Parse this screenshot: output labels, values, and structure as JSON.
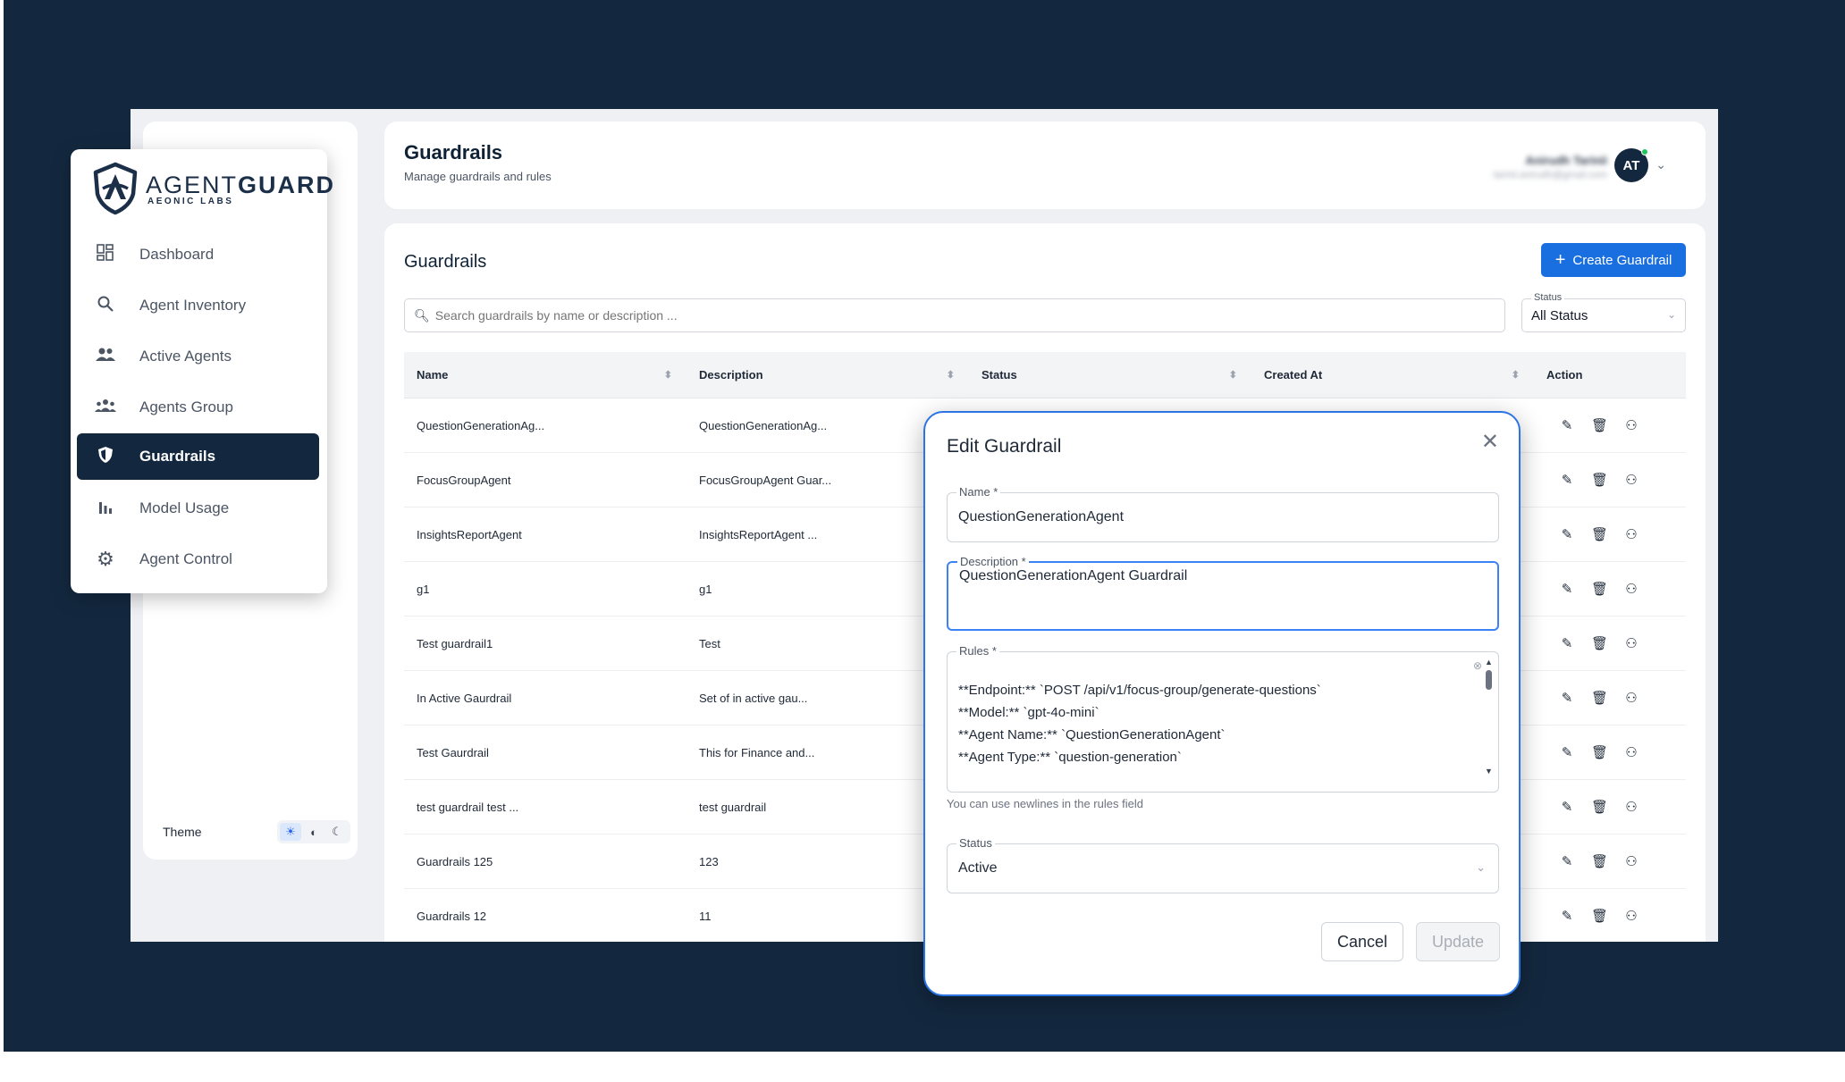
{
  "brand": {
    "name_light": "AGENT",
    "name_bold": "GUARD",
    "sub": "AEONIC LABS"
  },
  "nav": {
    "items": [
      {
        "label": "Dashboard",
        "icon": "dashboard-icon",
        "active": false
      },
      {
        "label": "Agent Inventory",
        "icon": "search-icon",
        "active": false
      },
      {
        "label": "Active Agents",
        "icon": "users-icon",
        "active": false
      },
      {
        "label": "Agents Group",
        "icon": "group-icon",
        "active": false
      },
      {
        "label": "Guardrails",
        "icon": "shield-icon",
        "active": true
      },
      {
        "label": "Model Usage",
        "icon": "bar-chart-icon",
        "active": false
      },
      {
        "label": "Agent Control",
        "icon": "gear-icon",
        "active": false
      }
    ]
  },
  "theme": {
    "label": "Theme"
  },
  "header": {
    "title": "Guardrails",
    "subtitle": "Manage guardrails and rules",
    "user_name": "Anirudh Tarinii",
    "user_email": "tarinii.anirudh@gmail.com",
    "avatar_initials": "AT"
  },
  "content": {
    "title": "Guardrails",
    "create_label": "Create Guardrail",
    "search_placeholder": "Search guardrails by name or description ...",
    "status_filter_label": "Status",
    "status_filter_value": "All Status"
  },
  "table": {
    "columns": [
      "Name",
      "Description",
      "Status",
      "Created At",
      "Action"
    ],
    "rows": [
      {
        "name": "QuestionGenerationAg...",
        "description": "QuestionGenerationAg..."
      },
      {
        "name": "FocusGroupAgent",
        "description": "FocusGroupAgent Guar..."
      },
      {
        "name": "InsightsReportAgent",
        "description": "InsightsReportAgent ..."
      },
      {
        "name": "g1",
        "description": "g1"
      },
      {
        "name": "Test guardrail1",
        "description": "Test"
      },
      {
        "name": "In Active Gaurdrail",
        "description": "Set of in active gau..."
      },
      {
        "name": "Test Gaurdrail",
        "description": "This for Finance and..."
      },
      {
        "name": "test guardrail test ...",
        "description": "test guardrail"
      },
      {
        "name": "Guardrails 125",
        "description": "123"
      },
      {
        "name": "Guardrails 12",
        "description": "11"
      }
    ]
  },
  "modal": {
    "title": "Edit Guardrail",
    "name_label": "Name *",
    "name_value": "QuestionGenerationAgent",
    "description_label": "Description *",
    "description_value": "QuestionGenerationAgent Guardrail",
    "rules_label": "Rules *",
    "rules_lines": [
      "**Endpoint:** `POST /api/v1/focus-group/generate-questions`",
      "**Model:** `gpt-4o-mini`",
      "**Agent Name:** `QuestionGenerationAgent`",
      "**Agent Type:** `question-generation`"
    ],
    "rules_helper": "You can use newlines in the rules field",
    "status_label": "Status",
    "status_value": "Active",
    "cancel_label": "Cancel",
    "update_label": "Update"
  },
  "colors": {
    "navy": "#13283f",
    "primary": "#1a6fe0",
    "modal_border": "#2b74e2"
  }
}
